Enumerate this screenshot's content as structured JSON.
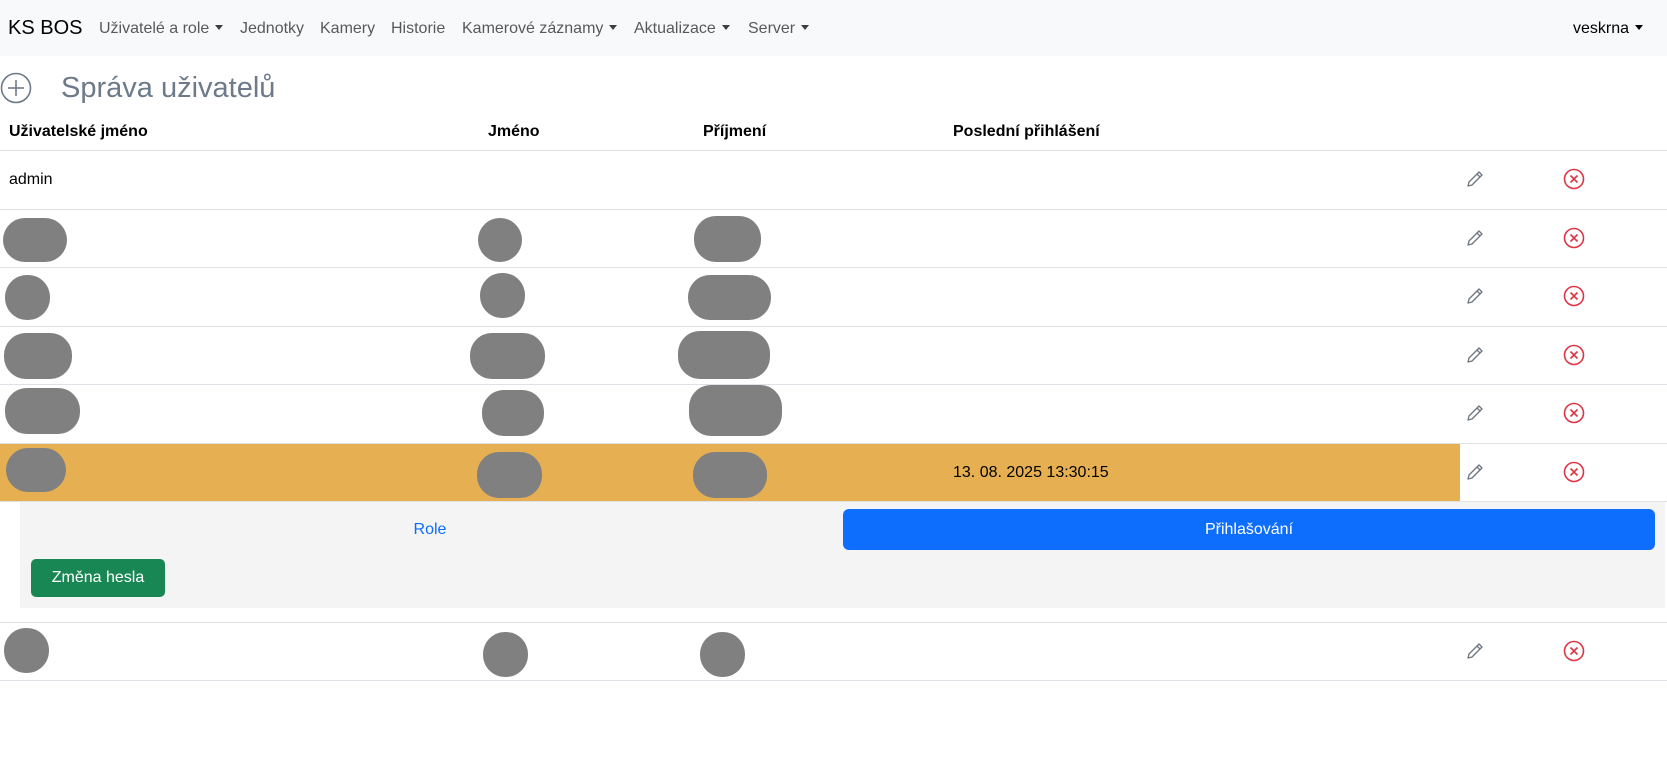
{
  "navbar": {
    "brand": "KS BOS",
    "items": [
      {
        "label": "Uživatelé a role",
        "dropdown": true
      },
      {
        "label": "Jednotky",
        "dropdown": false
      },
      {
        "label": "Kamery",
        "dropdown": false
      },
      {
        "label": "Historie",
        "dropdown": false
      },
      {
        "label": "Kamerové záznamy",
        "dropdown": true
      },
      {
        "label": "Aktualizace",
        "dropdown": true
      },
      {
        "label": "Server",
        "dropdown": true
      }
    ],
    "user": "veskrna"
  },
  "page": {
    "title": "Správa uživatelů",
    "add_icon": "plus-circle-icon"
  },
  "table": {
    "headers": {
      "username": "Uživatelské jméno",
      "first_name": "Jméno",
      "last_name": "Příjmení",
      "last_login": "Poslední přihlášení"
    },
    "rows": [
      {
        "username": "admin",
        "first_name": "",
        "last_name": "",
        "last_login": "",
        "redacted": false,
        "selected": false
      },
      {
        "username": "",
        "first_name": "",
        "last_name": "",
        "last_login": "",
        "redacted": true,
        "selected": false
      },
      {
        "username": "",
        "first_name": "",
        "last_name": "",
        "last_login": "",
        "redacted": true,
        "selected": false
      },
      {
        "username": "",
        "first_name": "",
        "last_name": "",
        "last_login": "",
        "redacted": true,
        "selected": false
      },
      {
        "username": "",
        "first_name": "",
        "last_name": "",
        "last_login": "",
        "redacted": true,
        "selected": false
      },
      {
        "username": "",
        "first_name": "",
        "last_name": "",
        "last_login": "13. 08. 2025 13:30:15",
        "redacted": true,
        "selected": true
      },
      {
        "username": "",
        "first_name": "",
        "last_name": "",
        "last_login": "",
        "redacted": true,
        "selected": false
      }
    ],
    "edit_icon": "pencil-icon",
    "delete_icon": "x-circle-icon"
  },
  "detail": {
    "tab_role": "Role",
    "tab_login": "Přihlašování",
    "change_password": "Změna hesla"
  },
  "colors": {
    "selected_row": "#e6b052",
    "primary": "#0d6efd",
    "success": "#198754",
    "danger": "#dc3545",
    "redaction": "#808080"
  }
}
